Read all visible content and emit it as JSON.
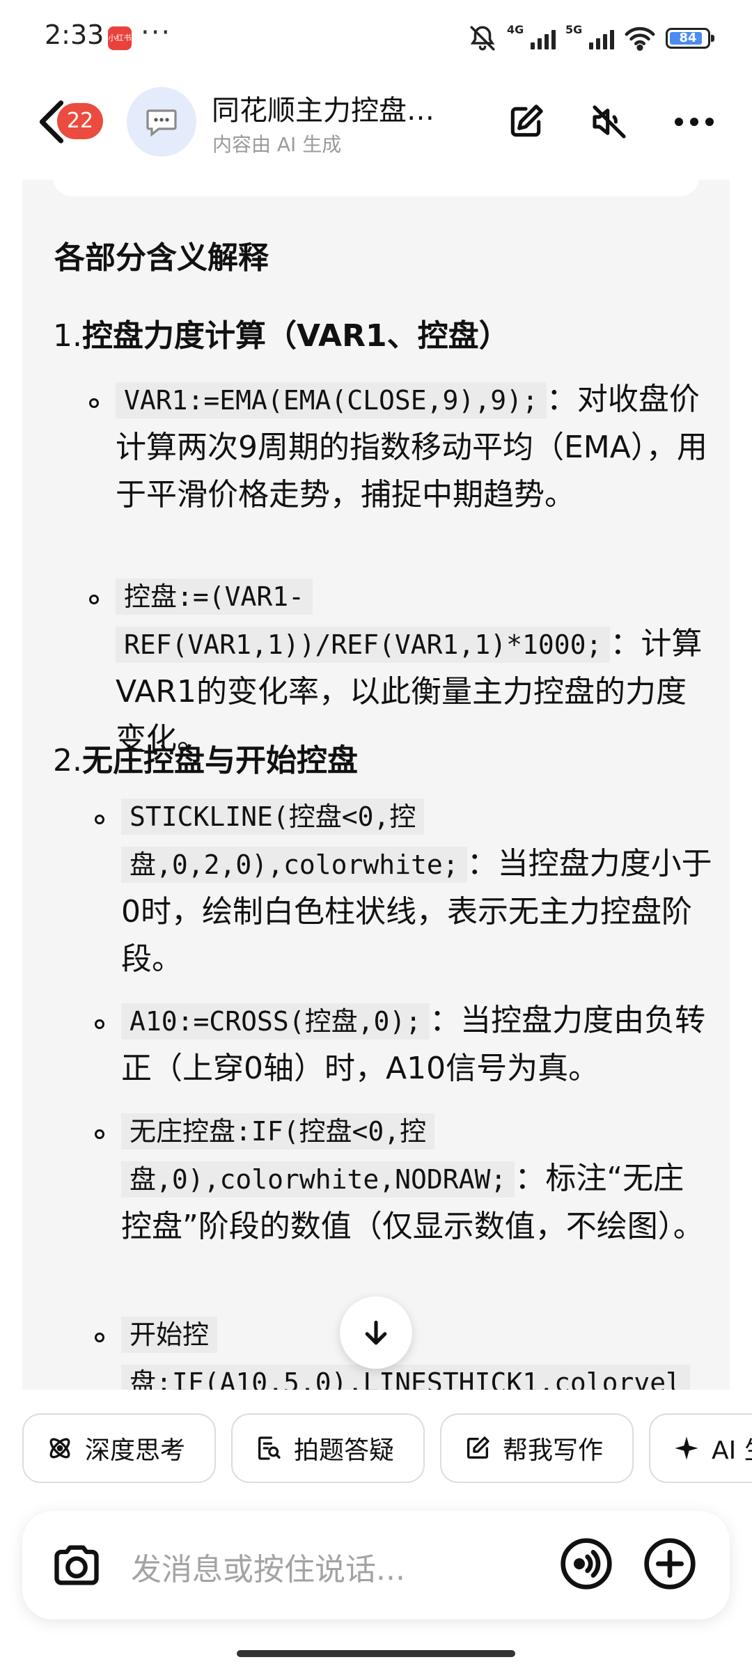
{
  "status_bar": {
    "time": "2:33",
    "app_icon_text": "小红书",
    "more": "···",
    "net1": "4G",
    "net2": "5G",
    "battery": "84",
    "icons": [
      "mute-bell-icon",
      "signal-icon",
      "wifi-icon",
      "battery-icon"
    ]
  },
  "header": {
    "unread_count": "22",
    "title": "同花顺主力控盘…",
    "subtitle": "内容由 AI 生成",
    "icons": [
      "back-icon",
      "edit-icon",
      "mute-icon",
      "more-icon"
    ]
  },
  "content": {
    "heading": "各部分含义解释",
    "sections": [
      {
        "num": "1.",
        "title": "控盘力度计算（VAR1、控盘）",
        "items": [
          {
            "code": "VAR1:=EMA(EMA(CLOSE,9),9);",
            "text": "：对收盘价计算两次9周期的指数移动平均（EMA），用于平滑价格走势，捕捉中期趋势。"
          },
          {
            "code": "控盘:=(VAR1-REF(VAR1,1))/REF(VAR1,1)*1000;",
            "text": "：计算VAR1的变化率，以此衡量主力控盘的力度变化。"
          }
        ]
      },
      {
        "num": "2.",
        "title": "无庄控盘与开始控盘",
        "items": [
          {
            "code": "STICKLINE(控盘<0,控盘,0,2,0),colorwhite;",
            "text": "：当控盘力度小于0时，绘制白色柱状线，表示无主力控盘阶段。"
          },
          {
            "code": "A10:=CROSS(控盘,0);",
            "text": "：当控盘力度由负转正（上穿0轴）时，A10信号为真。"
          },
          {
            "code": "无庄控盘:IF(控盘<0,控盘,0),colorwhite,NODRAW;",
            "text": "：标注“无庄控盘”阶段的数值（仅显示数值，不绘图）。"
          },
          {
            "code": "开始控盘:IF(A10,5,0),LINESTHICK1,colorvel",
            "text": ""
          }
        ]
      }
    ]
  },
  "chips": [
    {
      "label": "深度思考",
      "icon": "atom-icon"
    },
    {
      "label": "拍题答疑",
      "icon": "photo-search-icon"
    },
    {
      "label": "帮我写作",
      "icon": "write-icon"
    },
    {
      "label": "AI 生",
      "icon": "sparkle-icon"
    }
  ],
  "input": {
    "placeholder": "发消息或按住说话..."
  }
}
